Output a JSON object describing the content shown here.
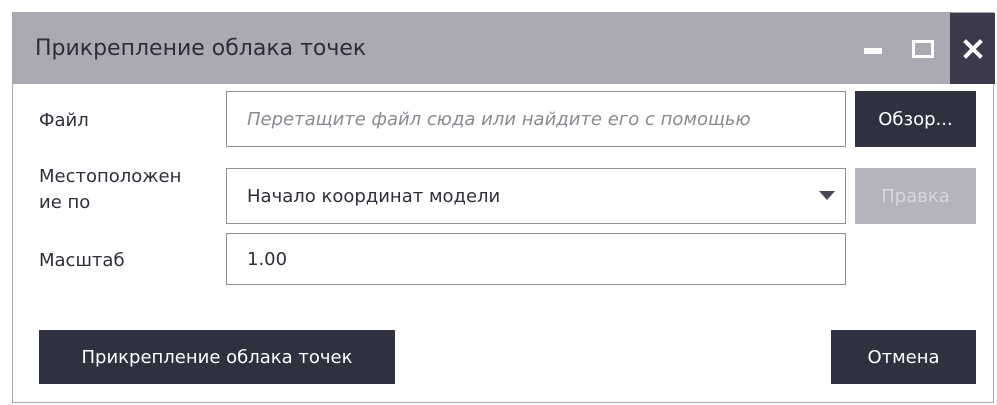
{
  "window": {
    "title": "Прикрепление облака точек",
    "controls": [
      "minimize-icon",
      "maximize-icon",
      "close-icon"
    ]
  },
  "form": {
    "file": {
      "label": "Файл",
      "placeholder": "Перетащите файл сюда или найдите его с помощью",
      "browse_label": "Обзор..."
    },
    "location": {
      "label_line1": "Местоположен",
      "label_line2": "ие по",
      "selected": "Начало координат модели",
      "edit_label": "Правка"
    },
    "scale": {
      "label": "Масштаб",
      "value": "1.00"
    }
  },
  "footer": {
    "attach_label": "Прикрепление облака точек",
    "cancel_label": "Отмена"
  },
  "colors": {
    "titlebar": "#a9aab4",
    "close_button": "#3a3a4b",
    "primary_button": "#2f3040",
    "disabled_button": "#b3b4bc"
  }
}
